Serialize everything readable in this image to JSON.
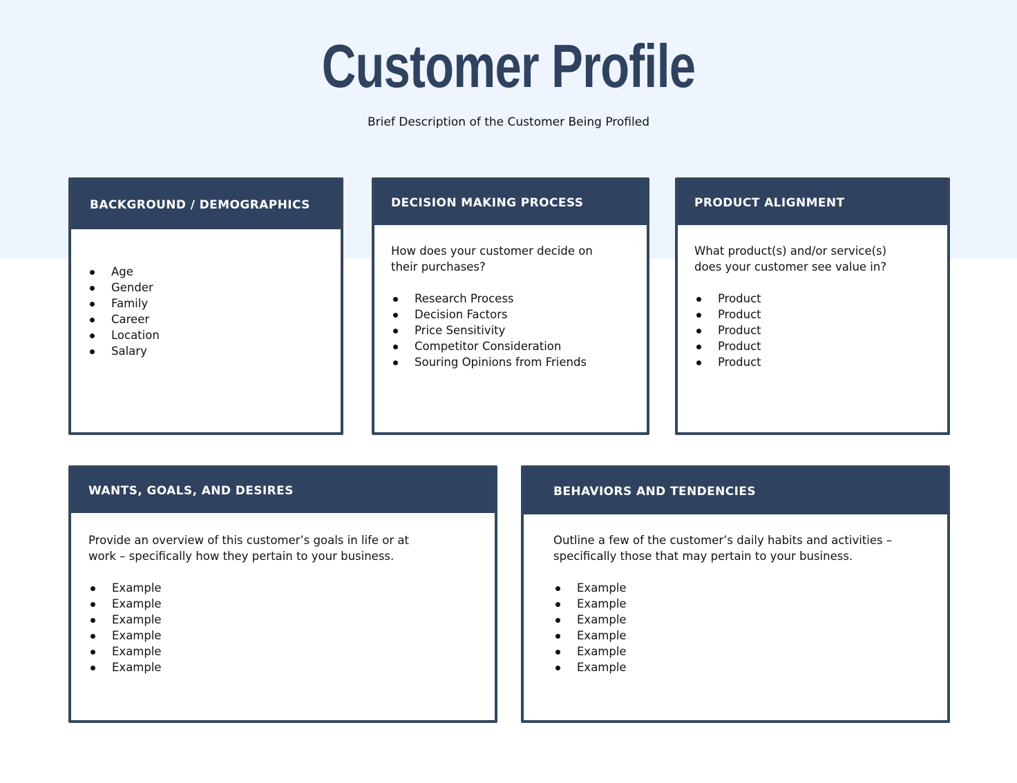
{
  "header": {
    "title": "Customer Profile",
    "subtitle": "Brief Description of the Customer Being Profiled"
  },
  "colors": {
    "accent": "#2f425f",
    "band_background": "#eff5fe",
    "card_background": "#ffffff"
  },
  "cards": [
    {
      "id": "background-demographics",
      "title": "BACKGROUND / DEMOGRAPHICS",
      "intro": "",
      "items": [
        "Age",
        "Gender",
        "Family",
        "Career",
        "Location",
        "Salary"
      ]
    },
    {
      "id": "decision-making-process",
      "title": "DECISION MAKING PROCESS",
      "intro": "How does your customer decide on their purchases?",
      "items": [
        "Research Process",
        "Decision Factors",
        "Price Sensitivity",
        "Competitor Consideration",
        "Souring Opinions from Friends"
      ]
    },
    {
      "id": "product-alignment",
      "title": "PRODUCT ALIGNMENT",
      "intro": "What product(s) and/or service(s) does your customer see value in?",
      "items": [
        "Product",
        "Product",
        "Product",
        "Product",
        "Product"
      ]
    },
    {
      "id": "wants-goals-desires",
      "title": "WANTS, GOALS, AND DESIRES",
      "intro": "Provide an overview of this customer’s goals in life or at work – specifically how they pertain to your business.",
      "items": [
        "Example",
        "Example",
        "Example",
        "Example",
        "Example",
        "Example"
      ]
    },
    {
      "id": "behaviors-tendencies",
      "title": "BEHAVIORS AND TENDENCIES",
      "intro": "Outline a few of the customer’s daily habits and activities – specifically those that may pertain to your business.",
      "items": [
        "Example",
        "Example",
        "Example",
        "Example",
        "Example",
        "Example"
      ]
    }
  ]
}
